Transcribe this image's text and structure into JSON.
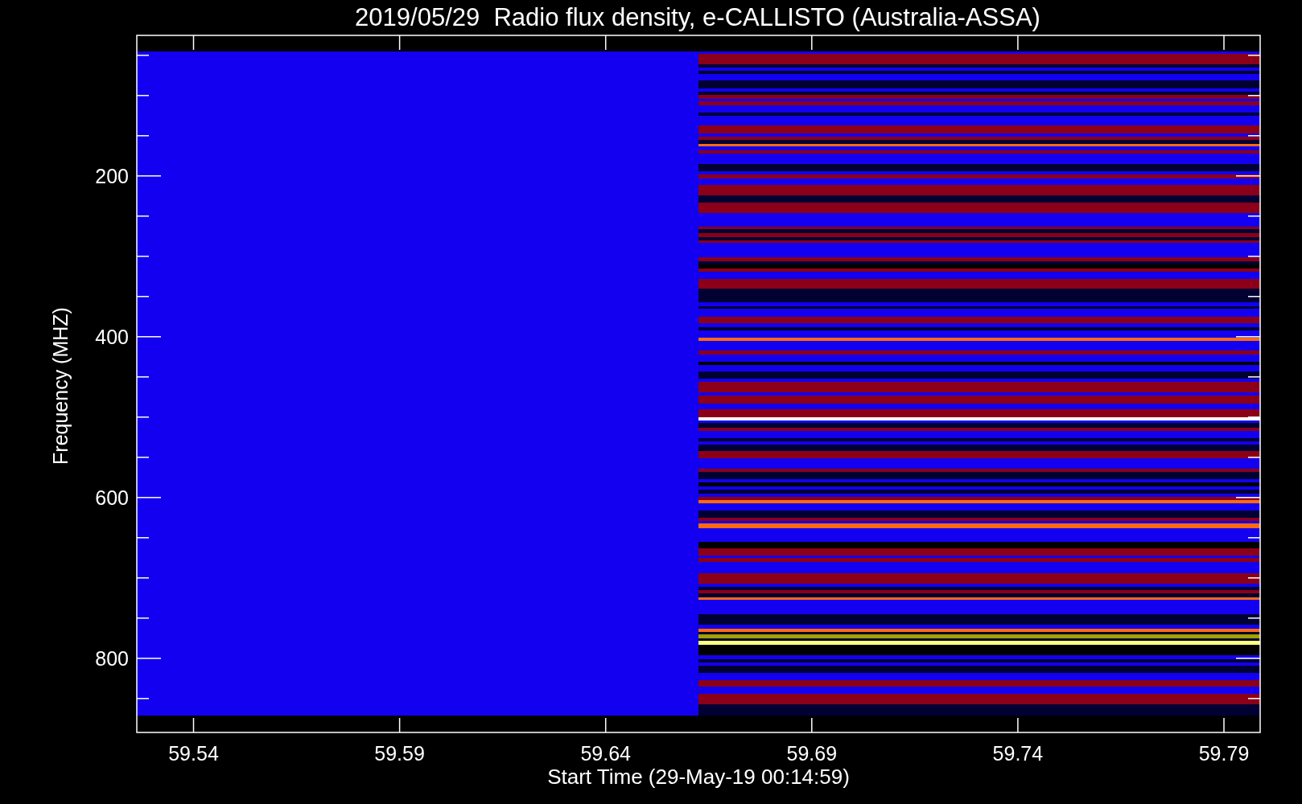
{
  "title": "2019/05/29  Radio flux density, e-CALLISTO (Australia-ASSA)",
  "x_axis": {
    "label": "Start Time (29-May-19 00:14:59)",
    "ticks": [
      "59.54",
      "59.59",
      "59.64",
      "59.69",
      "59.74",
      "59.79"
    ]
  },
  "y_axis": {
    "label": "Frequency (MHZ)",
    "ticks": [
      "200",
      "400",
      "600",
      "800"
    ]
  }
}
